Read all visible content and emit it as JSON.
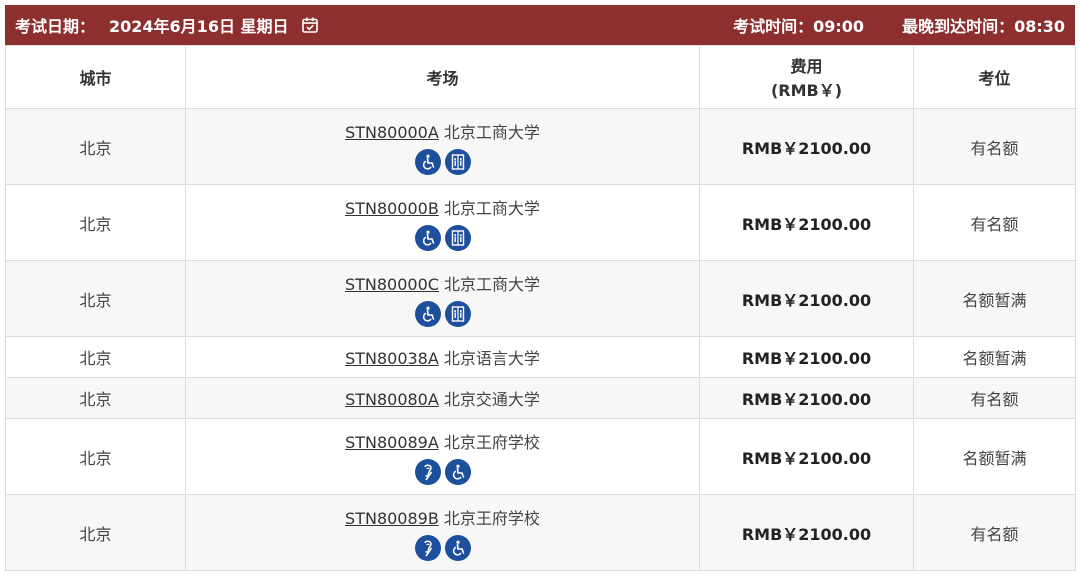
{
  "header": {
    "exam_date_label": "考试日期：",
    "exam_date_value": "2024年6月16日 星期日",
    "exam_time": "考试时间：09:00",
    "arrival_time": "最晚到达时间：08:30"
  },
  "columns": {
    "city": "城市",
    "venue": "考场",
    "fee_line1": "费用",
    "fee_line2": "(RMB￥)",
    "seats": "考位"
  },
  "rows": [
    {
      "city": "北京",
      "code": "STN80000A",
      "name": "北京工商大学",
      "fee": "RMB￥2100.00",
      "seats": "有名额",
      "icons": [
        "wheelchair-icon",
        "elevator-icon"
      ]
    },
    {
      "city": "北京",
      "code": "STN80000B",
      "name": "北京工商大学",
      "fee": "RMB￥2100.00",
      "seats": "有名额",
      "icons": [
        "wheelchair-icon",
        "elevator-icon"
      ]
    },
    {
      "city": "北京",
      "code": "STN80000C",
      "name": "北京工商大学",
      "fee": "RMB￥2100.00",
      "seats": "名额暂满",
      "icons": [
        "wheelchair-icon",
        "elevator-icon"
      ]
    },
    {
      "city": "北京",
      "code": "STN80038A",
      "name": "北京语言大学",
      "fee": "RMB￥2100.00",
      "seats": "名额暂满",
      "icons": []
    },
    {
      "city": "北京",
      "code": "STN80080A",
      "name": "北京交通大学",
      "fee": "RMB￥2100.00",
      "seats": "有名额",
      "icons": []
    },
    {
      "city": "北京",
      "code": "STN80089A",
      "name": "北京王府学校",
      "fee": "RMB￥2100.00",
      "seats": "名额暂满",
      "icons": [
        "hearing-icon",
        "wheelchair-icon"
      ]
    },
    {
      "city": "北京",
      "code": "STN80089B",
      "name": "北京王府学校",
      "fee": "RMB￥2100.00",
      "seats": "有名额",
      "icons": [
        "hearing-icon",
        "wheelchair-icon"
      ]
    }
  ],
  "colors": {
    "header_bg": "#8e2f2f",
    "icon_bg": "#1e4f9c",
    "row_alt": "#f7f7f7",
    "border": "#dddddd"
  }
}
